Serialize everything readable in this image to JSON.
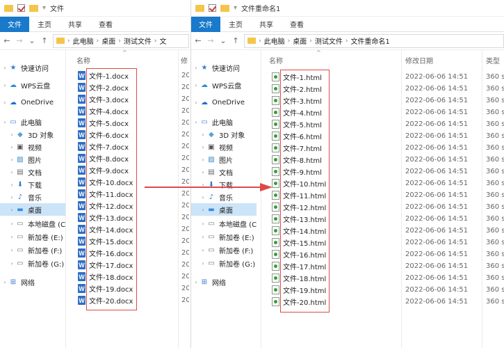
{
  "left_window": {
    "title": "文件",
    "ribbon_tabs": [
      "文件",
      "主页",
      "共享",
      "查看"
    ],
    "breadcrumb": [
      "此电脑",
      "桌面",
      "测试文件",
      "文"
    ],
    "nav_items": [
      {
        "label": "快速访问",
        "icon": "star-icon"
      },
      {
        "label": "WPS云盘",
        "icon": "cloud-icon"
      },
      {
        "label": "OneDrive",
        "icon": "onedrive-icon"
      },
      {
        "label": "此电脑",
        "icon": "computer-icon"
      },
      {
        "label": "3D 对象",
        "icon": "cube-icon"
      },
      {
        "label": "视频",
        "icon": "video-icon"
      },
      {
        "label": "图片",
        "icon": "picture-icon"
      },
      {
        "label": "文档",
        "icon": "document-icon"
      },
      {
        "label": "下载",
        "icon": "download-icon"
      },
      {
        "label": "音乐",
        "icon": "music-icon"
      },
      {
        "label": "桌面",
        "icon": "desktop-icon"
      },
      {
        "label": "本地磁盘 (C:",
        "icon": "drive-icon"
      },
      {
        "label": "新加卷 (E:)",
        "icon": "drive-icon"
      },
      {
        "label": "新加卷 (F:)",
        "icon": "drive-icon"
      },
      {
        "label": "新加卷 (G:)",
        "icon": "drive-icon"
      },
      {
        "label": "网络",
        "icon": "network-icon"
      }
    ],
    "columns": {
      "name": "名称",
      "date_clipped": "修"
    },
    "files": [
      "文件-1.docx",
      "文件-2.docx",
      "文件-3.docx",
      "文件-4.docx",
      "文件-5.docx",
      "文件-6.docx",
      "文件-7.docx",
      "文件-8.docx",
      "文件-9.docx",
      "文件-10.docx",
      "文件-11.docx",
      "文件-12.docx",
      "文件-13.docx",
      "文件-14.docx",
      "文件-15.docx",
      "文件-16.docx",
      "文件-17.docx",
      "文件-18.docx",
      "文件-19.docx",
      "文件-20.docx"
    ],
    "date_clip_text": "20"
  },
  "right_window": {
    "title": "文件重命名1",
    "ribbon_tabs": [
      "文件",
      "主页",
      "共享",
      "查看"
    ],
    "breadcrumb": [
      "此电脑",
      "桌面",
      "测试文件",
      "文件重命名1"
    ],
    "nav_items": [
      {
        "label": "快速访问",
        "icon": "star-icon"
      },
      {
        "label": "WPS云盘",
        "icon": "cloud-icon"
      },
      {
        "label": "OneDrive",
        "icon": "onedrive-icon"
      },
      {
        "label": "此电脑",
        "icon": "computer-icon"
      },
      {
        "label": "3D 对象",
        "icon": "cube-icon"
      },
      {
        "label": "视频",
        "icon": "video-icon"
      },
      {
        "label": "图片",
        "icon": "picture-icon"
      },
      {
        "label": "文档",
        "icon": "document-icon"
      },
      {
        "label": "下载",
        "icon": "download-icon"
      },
      {
        "label": "音乐",
        "icon": "music-icon"
      },
      {
        "label": "桌面",
        "icon": "desktop-icon"
      },
      {
        "label": "本地磁盘 (C:",
        "icon": "drive-icon"
      },
      {
        "label": "新加卷 (E:)",
        "icon": "drive-icon"
      },
      {
        "label": "新加卷 (F:)",
        "icon": "drive-icon"
      },
      {
        "label": "新加卷 (G:)",
        "icon": "drive-icon"
      },
      {
        "label": "网络",
        "icon": "network-icon"
      }
    ],
    "columns": {
      "name": "名称",
      "date": "修改日期",
      "type": "类型"
    },
    "files": [
      {
        "name": "文件-1.html",
        "date": "2022-06-06 14:51",
        "type": "360 s"
      },
      {
        "name": "文件-2.html",
        "date": "2022-06-06 14:51",
        "type": "360 s"
      },
      {
        "name": "文件-3.html",
        "date": "2022-06-06 14:51",
        "type": "360 s"
      },
      {
        "name": "文件-4.html",
        "date": "2022-06-06 14:51",
        "type": "360 s"
      },
      {
        "name": "文件-5.html",
        "date": "2022-06-06 14:51",
        "type": "360 s"
      },
      {
        "name": "文件-6.html",
        "date": "2022-06-06 14:51",
        "type": "360 s"
      },
      {
        "name": "文件-7.html",
        "date": "2022-06-06 14:51",
        "type": "360 s"
      },
      {
        "name": "文件-8.html",
        "date": "2022-06-06 14:51",
        "type": "360 s"
      },
      {
        "name": "文件-9.html",
        "date": "2022-06-06 14:51",
        "type": "360 s"
      },
      {
        "name": "文件-10.html",
        "date": "2022-06-06 14:51",
        "type": "360 s"
      },
      {
        "name": "文件-11.html",
        "date": "2022-06-06 14:51",
        "type": "360 s"
      },
      {
        "name": "文件-12.html",
        "date": "2022-06-06 14:51",
        "type": "360 s"
      },
      {
        "name": "文件-13.html",
        "date": "2022-06-06 14:51",
        "type": "360 s"
      },
      {
        "name": "文件-14.html",
        "date": "2022-06-06 14:51",
        "type": "360 s"
      },
      {
        "name": "文件-15.html",
        "date": "2022-06-06 14:51",
        "type": "360 s"
      },
      {
        "name": "文件-16.html",
        "date": "2022-06-06 14:51",
        "type": "360 s"
      },
      {
        "name": "文件-17.html",
        "date": "2022-06-06 14:51",
        "type": "360 s"
      },
      {
        "name": "文件-18.html",
        "date": "2022-06-06 14:51",
        "type": "360 s"
      },
      {
        "name": "文件-19.html",
        "date": "2022-06-06 14:51",
        "type": "360 s"
      },
      {
        "name": "文件-20.html",
        "date": "2022-06-06 14:51",
        "type": "360 s"
      }
    ]
  },
  "colors": {
    "accent": "#1979ca",
    "highlight_box": "#e04848",
    "selected_nav": "#cce4f7",
    "arrow": "#e04848"
  }
}
